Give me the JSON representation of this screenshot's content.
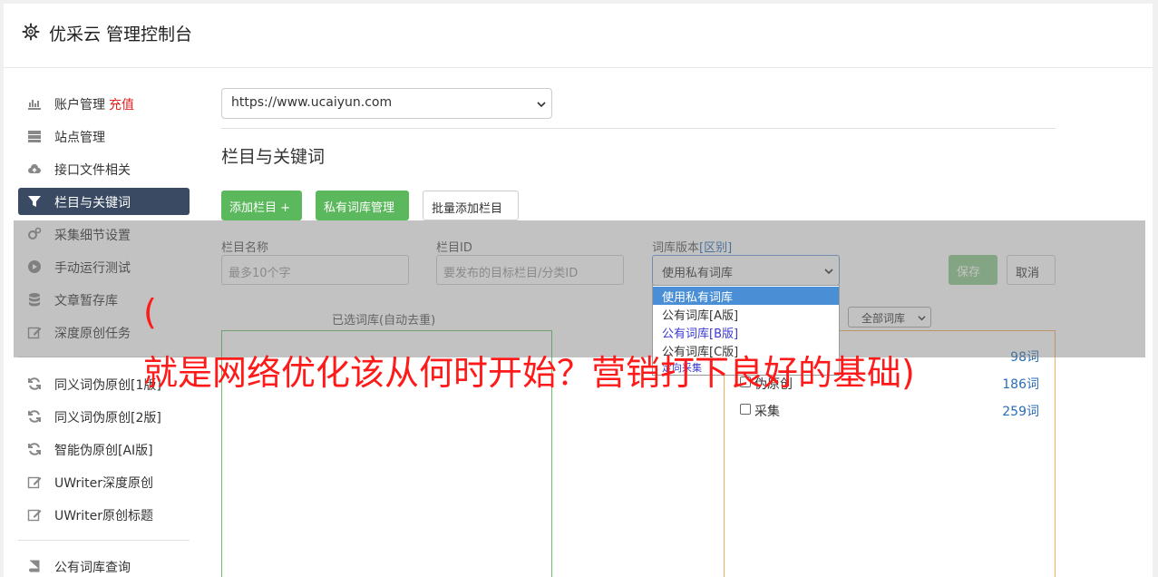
{
  "header": {
    "title": "优采云 管理控制台"
  },
  "sidebar": {
    "items": [
      {
        "label": "账户管理",
        "badge": "充值",
        "icon": "bar-chart-icon"
      },
      {
        "label": "站点管理",
        "icon": "server-icon"
      },
      {
        "label": "接口文件相关",
        "icon": "cloud-upload-icon"
      },
      {
        "label": "栏目与关键词",
        "icon": "filter-icon",
        "active": true
      },
      {
        "label": "采集细节设置",
        "icon": "gears-icon"
      },
      {
        "label": "手动运行测试",
        "icon": "play-circle-icon"
      },
      {
        "label": "文章暂存库",
        "icon": "database-icon"
      },
      {
        "label": "深度原创任务",
        "icon": "edit-icon"
      },
      {
        "label": "同义词伪原创[1版]",
        "icon": "refresh-icon"
      },
      {
        "label": "同义词伪原创[2版]",
        "icon": "refresh-icon"
      },
      {
        "label": "智能伪原创[AI版]",
        "icon": "refresh-icon"
      },
      {
        "label": "UWriter深度原创",
        "icon": "edit-icon"
      },
      {
        "label": "UWriter原创标题",
        "icon": "edit-icon"
      },
      {
        "label": "公有词库查询",
        "icon": "book-icon"
      }
    ]
  },
  "main": {
    "site_select": "https://www.ucaiyun.com",
    "section_title": "栏目与关键词",
    "buttons": {
      "add_column": "添加栏目 +",
      "private_lib": "私有词库管理",
      "batch_add": "批量添加栏目"
    },
    "form": {
      "name_label": "栏目名称",
      "name_placeholder": "最多10个字",
      "id_label": "栏目ID",
      "id_placeholder": "要发布的目标栏目/分类ID",
      "lib_label": "词库版本",
      "lib_label_link": "[区别]",
      "lib_select": "使用私有词库",
      "save": "保存",
      "cancel": "取消"
    },
    "dropdown_options": [
      "使用私有词库",
      "公有词库[A版]",
      "公有词库[B版]",
      "公有词库[C版]",
      "定向采集"
    ],
    "selected_caption": "已选词库(自动去重)",
    "filter_select": "全部词库",
    "libraries": [
      {
        "name": "",
        "count": "98词"
      },
      {
        "name": "伪原创",
        "count": "186词"
      },
      {
        "name": "采集",
        "count": "259词"
      }
    ]
  },
  "watermark": {
    "open_paren": "(",
    "text": "就是网络优化该从何时开始？营销打下良好的基础)"
  },
  "colors": {
    "accent_green": "#5cb85c",
    "active_nav": "#3a4a63",
    "watermark_red": "#ff1a1a"
  }
}
